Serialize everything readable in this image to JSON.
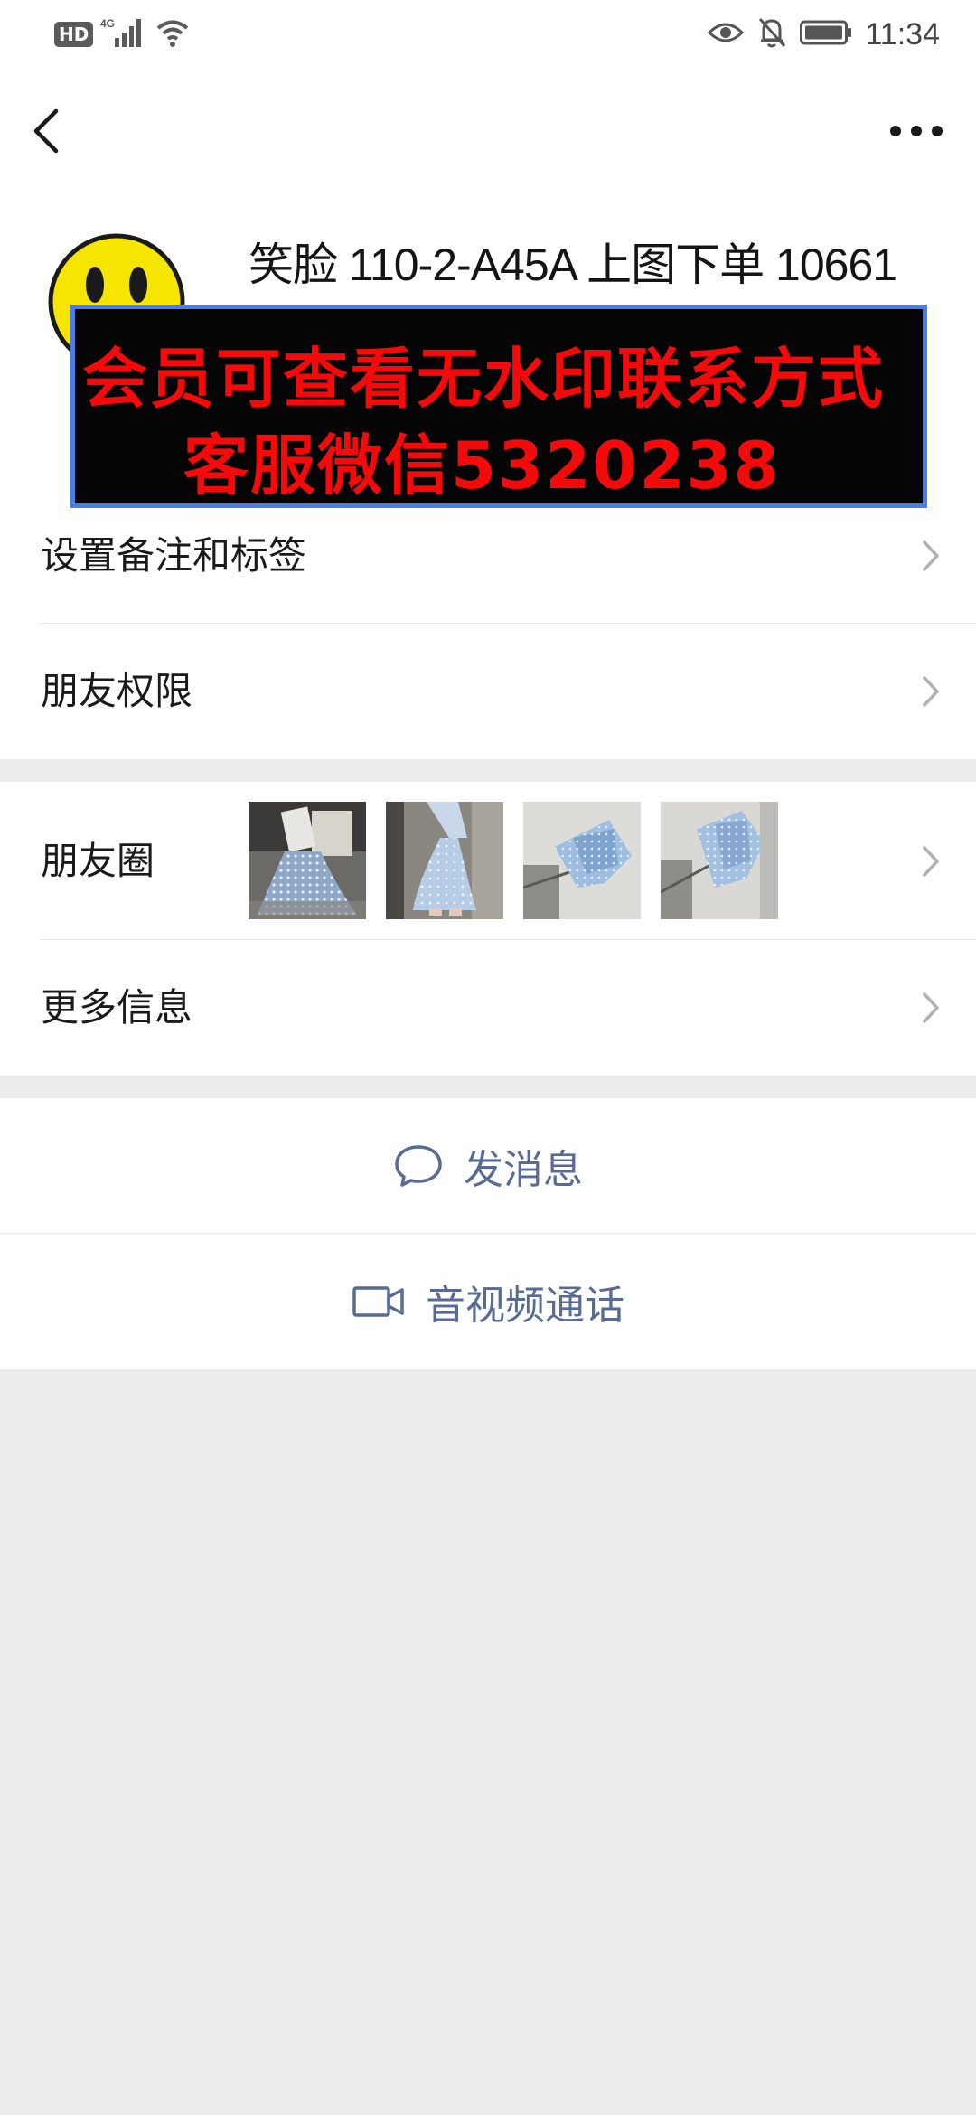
{
  "status_bar": {
    "hd_label": "HD",
    "network_label": "4G",
    "time": "11:34"
  },
  "profile": {
    "name": "笑脸 110-2-A45A 上图下单 10661",
    "watermark_line1": "会员可查看无水印联系方式",
    "watermark_line2": "客服微信5320238"
  },
  "menu_group1": [
    {
      "label": "设置备注和标签"
    },
    {
      "label": "朋友权限"
    }
  ],
  "menu_group2": {
    "moments_label": "朋友圈",
    "more_info_label": "更多信息"
  },
  "actions": {
    "send_message_label": "发消息",
    "video_call_label": "音视频通话"
  },
  "colors": {
    "link_blue": "#576b95",
    "watermark_red": "#f30b0b",
    "watermark_border": "#4a7de8",
    "background": "#ededed"
  }
}
